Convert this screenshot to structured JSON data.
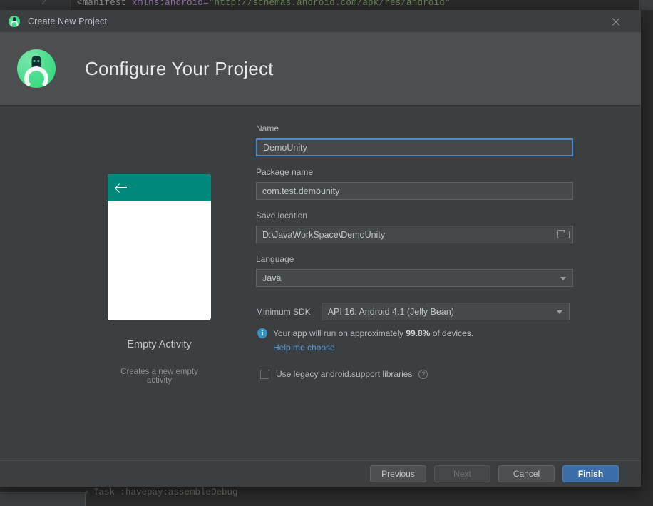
{
  "background": {
    "line_number": "2",
    "code_tag": "<manifest",
    "code_attr": "xmlns:android=",
    "code_string": "\"http://schemas.android.com/apk/res/android\"",
    "bottom_task": "Task :havepay:assembleDebug",
    "bottom_arrow": "›"
  },
  "titlebar": {
    "icon": "android-studio-icon",
    "title": "Create New Project",
    "close_icon": "close-icon"
  },
  "header": {
    "logo": "android-studio-logo",
    "title": "Configure Your Project"
  },
  "preview": {
    "back_icon": "back-arrow-icon",
    "template_name": "Empty Activity",
    "template_description": "Creates a new empty activity",
    "appbar_color": "#00897B"
  },
  "form": {
    "name": {
      "label": "Name",
      "value": "DemoUnity",
      "focused": true
    },
    "package_name": {
      "label": "Package name",
      "value": "com.test.demounity"
    },
    "save_location": {
      "label": "Save location",
      "value": "D:\\JavaWorkSpace\\DemoUnity",
      "browse_icon": "folder-icon"
    },
    "language": {
      "label": "Language",
      "value": "Java",
      "caret_icon": "chevron-down-icon"
    },
    "minimum_sdk": {
      "label": "Minimum SDK",
      "value": "API 16: Android 4.1 (Jelly Bean)",
      "caret_icon": "chevron-down-icon"
    },
    "device_info": {
      "icon": "info-icon",
      "text_before": "Your app will run on approximately ",
      "percent": "99.8%",
      "text_after": " of devices.",
      "help_link": "Help me choose"
    },
    "legacy_libraries": {
      "label": "Use legacy android.support libraries",
      "checked": false,
      "help_icon": "?"
    }
  },
  "footer": {
    "previous": "Previous",
    "next": "Next",
    "next_disabled": true,
    "cancel": "Cancel",
    "finish": "Finish"
  },
  "colors": {
    "dialog_bg": "#3C3F41",
    "header_bg": "#4D4E50",
    "accent_blue": "#3B6EA8",
    "focus_blue": "#4A88C7",
    "link_blue": "#599AD6",
    "teal": "#00897B",
    "android_green": "#3DDC84"
  }
}
